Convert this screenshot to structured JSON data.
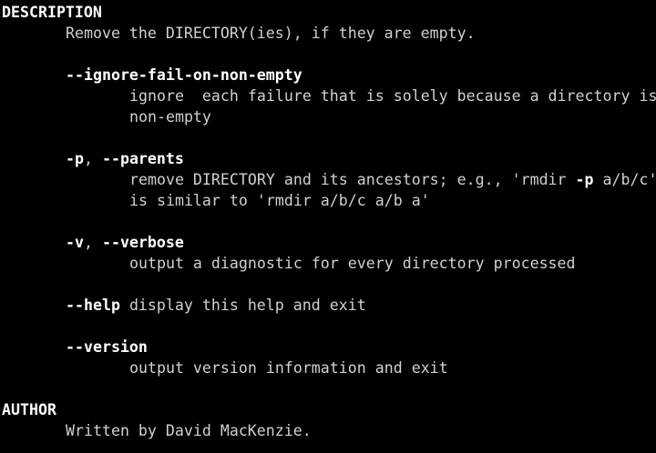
{
  "sections": {
    "description_heading": "DESCRIPTION",
    "author_heading": "AUTHOR"
  },
  "description": {
    "summary": "Remove the DIRECTORY(ies), if they are empty."
  },
  "options": {
    "ignore": {
      "flag": "--ignore-fail-on-non-empty",
      "desc1": "ignore  each failure that is solely because a directory is",
      "desc2": "non-empty"
    },
    "parents": {
      "short": "-p",
      "sep": ", ",
      "long": "--parents",
      "desc1_a": "remove DIRECTORY and its ancestors; e.g., 'rmdir ",
      "desc1_flag": "-p",
      "desc1_b": " a/b/c'",
      "desc2": "is similar to 'rmdir a/b/c a/b a'"
    },
    "verbose": {
      "short": "-v",
      "sep": ", ",
      "long": "--verbose",
      "desc1": "output a diagnostic for every directory processed"
    },
    "help": {
      "flag": "--help",
      "desc": " display this help and exit"
    },
    "version": {
      "flag": "--version",
      "desc1": "output version information and exit"
    }
  },
  "author": {
    "text": "Written by David MacKenzie."
  },
  "colors": {
    "background": "#000000",
    "text": "#d0d0d0",
    "bold": "#ffffff"
  }
}
